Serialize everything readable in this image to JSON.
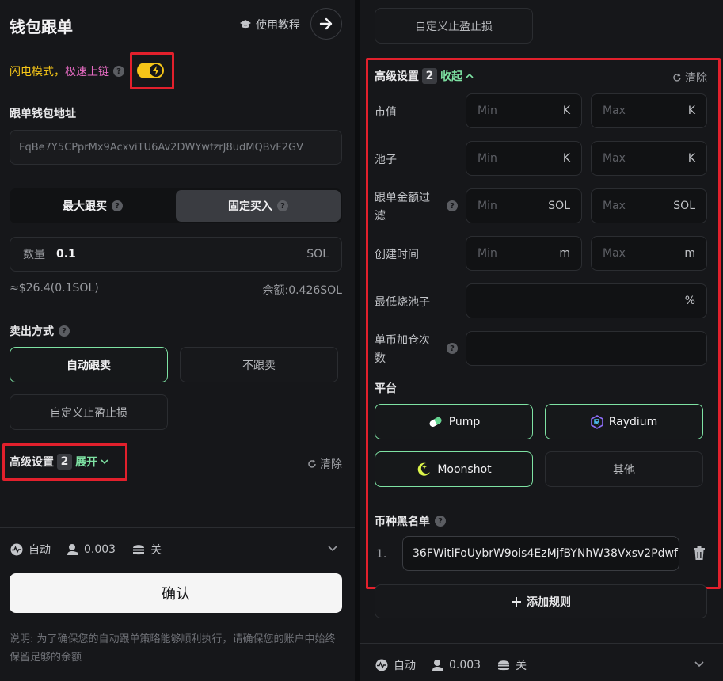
{
  "left": {
    "title": "钱包跟单",
    "tutorial_label": "使用教程",
    "flash_mode_label": "闪电模式，",
    "fast_chain_label": "极速上链",
    "wallet_address_label": "跟单钱包地址",
    "wallet_address_value": "FqBe7Y5CPprMx9AcxviTU6Av2DWYwfzrJ8udMQBvF2GV",
    "tabs": {
      "max_buy": "最大跟买",
      "fixed_buy": "固定买入"
    },
    "quantity_label": "数量",
    "quantity_value": "0.1",
    "quantity_unit": "SOL",
    "approx_value": "≈$26.4(0.1SOL)",
    "balance": "余额:0.426SOL",
    "sell_method_label": "卖出方式",
    "sell_options": {
      "auto": "自动跟卖",
      "no_follow": "不跟卖",
      "custom_tp_sl": "自定义止盈止损"
    },
    "advanced": {
      "label": "高级设置",
      "count": "2",
      "expand": "展开",
      "clear": "清除"
    },
    "footer": {
      "auto": "自动",
      "fee": "0.003",
      "off": "关"
    },
    "confirm": "确认",
    "note": "说明: 为了确保您的自动跟单策略能够顺利执行，请确保您的账户中始终保留足够的余额"
  },
  "right": {
    "custom_tp_sl": "自定义止盈止损",
    "advanced": {
      "label": "高级设置",
      "count": "2",
      "collapse": "收起",
      "clear": "清除"
    },
    "filters": {
      "market_cap": {
        "label": "市值",
        "min": "Min",
        "max": "Max",
        "unit": "K"
      },
      "pool": {
        "label": "池子",
        "min": "Min",
        "max": "Max",
        "unit": "K"
      },
      "amount_filter": {
        "label_line1": "跟单金额过",
        "label_line2": "滤",
        "min": "Min",
        "max": "Max",
        "unit": "SOL"
      },
      "created_time": {
        "label": "创建时间",
        "min": "Min",
        "max": "Max",
        "unit": "m"
      },
      "min_burn_pool": {
        "label": "最低烧池子",
        "unit": "%"
      },
      "add_position_count": {
        "label_line1": "单币加仓次",
        "label_line2": "数"
      }
    },
    "platform_label": "平台",
    "platforms": {
      "pump": "Pump",
      "raydium": "Raydium",
      "moonshot": "Moonshot",
      "other": "其他"
    },
    "blacklist_label": "币种黑名单",
    "blacklist": [
      {
        "index": "1.",
        "value": "36FWitiFoUybrW9ois4EzMjfBYNhW38Vxsv2Pdwf"
      }
    ],
    "add_rule": "添加规则",
    "footer": {
      "auto": "自动",
      "fee": "0.003",
      "off": "关"
    }
  },
  "colors": {
    "accent_green": "#7ee2a3",
    "toggle_yellow": "#f5c518",
    "highlight_red": "#e2202c",
    "flash_yellow": "#f5c518",
    "fast_pink": "#e86cc4"
  }
}
